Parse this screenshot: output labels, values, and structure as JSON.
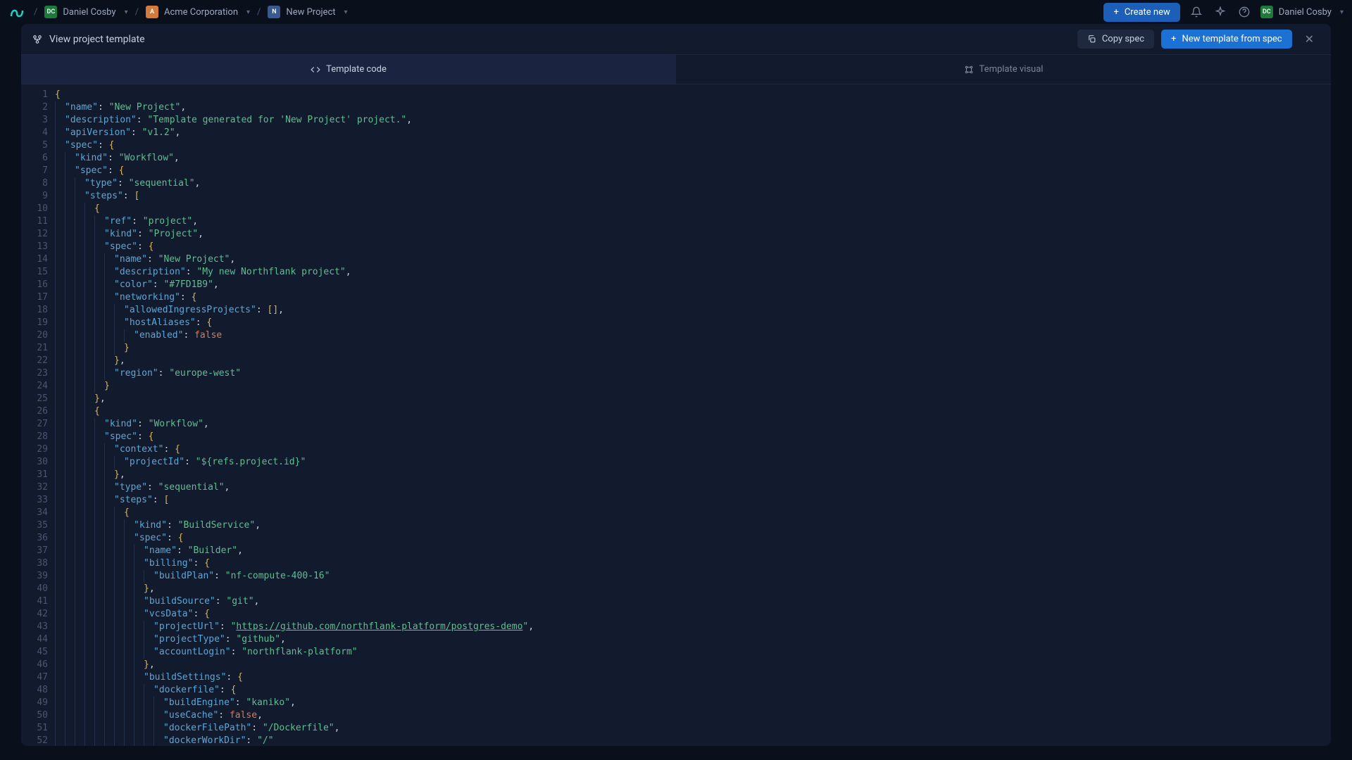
{
  "topbar": {
    "user": "Daniel Cosby",
    "org": "Acme Corporation",
    "project": "New Project",
    "create_new": "Create new"
  },
  "modal": {
    "title": "View project template",
    "copy_spec": "Copy spec",
    "new_template": "New template from spec"
  },
  "tabs": {
    "code": "Template code",
    "visual": "Template visual"
  },
  "code": {
    "lines": [
      {
        "n": 1,
        "i": 0,
        "t": [
          [
            "brace",
            "{"
          ]
        ]
      },
      {
        "n": 2,
        "i": 1,
        "t": [
          [
            "key",
            "\"name\""
          ],
          [
            "punct",
            ": "
          ],
          [
            "str",
            "\"New Project\""
          ],
          [
            "punct",
            ","
          ]
        ]
      },
      {
        "n": 3,
        "i": 1,
        "t": [
          [
            "key",
            "\"description\""
          ],
          [
            "punct",
            ": "
          ],
          [
            "str",
            "\"Template generated for 'New Project' project.\""
          ],
          [
            "punct",
            ","
          ]
        ]
      },
      {
        "n": 4,
        "i": 1,
        "t": [
          [
            "key",
            "\"apiVersion\""
          ],
          [
            "punct",
            ": "
          ],
          [
            "str",
            "\"v1.2\""
          ],
          [
            "punct",
            ","
          ]
        ]
      },
      {
        "n": 5,
        "i": 1,
        "t": [
          [
            "key",
            "\"spec\""
          ],
          [
            "punct",
            ": "
          ],
          [
            "brace",
            "{"
          ]
        ]
      },
      {
        "n": 6,
        "i": 2,
        "t": [
          [
            "key",
            "\"kind\""
          ],
          [
            "punct",
            ": "
          ],
          [
            "str",
            "\"Workflow\""
          ],
          [
            "punct",
            ","
          ]
        ]
      },
      {
        "n": 7,
        "i": 2,
        "t": [
          [
            "key",
            "\"spec\""
          ],
          [
            "punct",
            ": "
          ],
          [
            "brace",
            "{"
          ]
        ]
      },
      {
        "n": 8,
        "i": 3,
        "t": [
          [
            "key",
            "\"type\""
          ],
          [
            "punct",
            ": "
          ],
          [
            "str",
            "\"sequential\""
          ],
          [
            "punct",
            ","
          ]
        ]
      },
      {
        "n": 9,
        "i": 3,
        "t": [
          [
            "key",
            "\"steps\""
          ],
          [
            "punct",
            ": "
          ],
          [
            "brace",
            "["
          ]
        ]
      },
      {
        "n": 10,
        "i": 4,
        "t": [
          [
            "brace",
            "{"
          ]
        ]
      },
      {
        "n": 11,
        "i": 5,
        "t": [
          [
            "key",
            "\"ref\""
          ],
          [
            "punct",
            ": "
          ],
          [
            "str",
            "\"project\""
          ],
          [
            "punct",
            ","
          ]
        ]
      },
      {
        "n": 12,
        "i": 5,
        "t": [
          [
            "key",
            "\"kind\""
          ],
          [
            "punct",
            ": "
          ],
          [
            "str",
            "\"Project\""
          ],
          [
            "punct",
            ","
          ]
        ]
      },
      {
        "n": 13,
        "i": 5,
        "t": [
          [
            "key",
            "\"spec\""
          ],
          [
            "punct",
            ": "
          ],
          [
            "brace",
            "{"
          ]
        ]
      },
      {
        "n": 14,
        "i": 6,
        "t": [
          [
            "key",
            "\"name\""
          ],
          [
            "punct",
            ": "
          ],
          [
            "str",
            "\"New Project\""
          ],
          [
            "punct",
            ","
          ]
        ]
      },
      {
        "n": 15,
        "i": 6,
        "t": [
          [
            "key",
            "\"description\""
          ],
          [
            "punct",
            ": "
          ],
          [
            "str",
            "\"My new Northflank project\""
          ],
          [
            "punct",
            ","
          ]
        ]
      },
      {
        "n": 16,
        "i": 6,
        "t": [
          [
            "key",
            "\"color\""
          ],
          [
            "punct",
            ": "
          ],
          [
            "str",
            "\"#7FD1B9\""
          ],
          [
            "punct",
            ","
          ]
        ]
      },
      {
        "n": 17,
        "i": 6,
        "t": [
          [
            "key",
            "\"networking\""
          ],
          [
            "punct",
            ": "
          ],
          [
            "brace",
            "{"
          ]
        ]
      },
      {
        "n": 18,
        "i": 7,
        "t": [
          [
            "key",
            "\"allowedIngressProjects\""
          ],
          [
            "punct",
            ": "
          ],
          [
            "brace",
            "[]"
          ],
          [
            "punct",
            ","
          ]
        ]
      },
      {
        "n": 19,
        "i": 7,
        "t": [
          [
            "key",
            "\"hostAliases\""
          ],
          [
            "punct",
            ": "
          ],
          [
            "brace",
            "{"
          ]
        ]
      },
      {
        "n": 20,
        "i": 8,
        "t": [
          [
            "key",
            "\"enabled\""
          ],
          [
            "punct",
            ": "
          ],
          [
            "bool",
            "false"
          ]
        ]
      },
      {
        "n": 21,
        "i": 7,
        "t": [
          [
            "brace",
            "}"
          ]
        ]
      },
      {
        "n": 22,
        "i": 6,
        "t": [
          [
            "brace",
            "}"
          ],
          [
            "punct",
            ","
          ]
        ]
      },
      {
        "n": 23,
        "i": 6,
        "t": [
          [
            "key",
            "\"region\""
          ],
          [
            "punct",
            ": "
          ],
          [
            "str",
            "\"europe-west\""
          ]
        ]
      },
      {
        "n": 24,
        "i": 5,
        "t": [
          [
            "brace",
            "}"
          ]
        ]
      },
      {
        "n": 25,
        "i": 4,
        "t": [
          [
            "brace",
            "}"
          ],
          [
            "punct",
            ","
          ]
        ]
      },
      {
        "n": 26,
        "i": 4,
        "t": [
          [
            "brace",
            "{"
          ]
        ]
      },
      {
        "n": 27,
        "i": 5,
        "t": [
          [
            "key",
            "\"kind\""
          ],
          [
            "punct",
            ": "
          ],
          [
            "str",
            "\"Workflow\""
          ],
          [
            "punct",
            ","
          ]
        ]
      },
      {
        "n": 28,
        "i": 5,
        "t": [
          [
            "key",
            "\"spec\""
          ],
          [
            "punct",
            ": "
          ],
          [
            "brace",
            "{"
          ]
        ]
      },
      {
        "n": 29,
        "i": 6,
        "t": [
          [
            "key",
            "\"context\""
          ],
          [
            "punct",
            ": "
          ],
          [
            "brace",
            "{"
          ]
        ]
      },
      {
        "n": 30,
        "i": 7,
        "t": [
          [
            "key",
            "\"projectId\""
          ],
          [
            "punct",
            ": "
          ],
          [
            "str",
            "\"${refs.project.id}\""
          ]
        ]
      },
      {
        "n": 31,
        "i": 6,
        "t": [
          [
            "brace",
            "}"
          ],
          [
            "punct",
            ","
          ]
        ]
      },
      {
        "n": 32,
        "i": 6,
        "t": [
          [
            "key",
            "\"type\""
          ],
          [
            "punct",
            ": "
          ],
          [
            "str",
            "\"sequential\""
          ],
          [
            "punct",
            ","
          ]
        ]
      },
      {
        "n": 33,
        "i": 6,
        "t": [
          [
            "key",
            "\"steps\""
          ],
          [
            "punct",
            ": "
          ],
          [
            "brace",
            "["
          ]
        ]
      },
      {
        "n": 34,
        "i": 7,
        "t": [
          [
            "brace",
            "{"
          ]
        ]
      },
      {
        "n": 35,
        "i": 8,
        "t": [
          [
            "key",
            "\"kind\""
          ],
          [
            "punct",
            ": "
          ],
          [
            "str",
            "\"BuildService\""
          ],
          [
            "punct",
            ","
          ]
        ]
      },
      {
        "n": 36,
        "i": 8,
        "t": [
          [
            "key",
            "\"spec\""
          ],
          [
            "punct",
            ": "
          ],
          [
            "brace",
            "{"
          ]
        ]
      },
      {
        "n": 37,
        "i": 9,
        "t": [
          [
            "key",
            "\"name\""
          ],
          [
            "punct",
            ": "
          ],
          [
            "str",
            "\"Builder\""
          ],
          [
            "punct",
            ","
          ]
        ]
      },
      {
        "n": 38,
        "i": 9,
        "t": [
          [
            "key",
            "\"billing\""
          ],
          [
            "punct",
            ": "
          ],
          [
            "brace",
            "{"
          ]
        ]
      },
      {
        "n": 39,
        "i": 10,
        "t": [
          [
            "key",
            "\"buildPlan\""
          ],
          [
            "punct",
            ": "
          ],
          [
            "str",
            "\"nf-compute-400-16\""
          ]
        ]
      },
      {
        "n": 40,
        "i": 9,
        "t": [
          [
            "brace",
            "}"
          ],
          [
            "punct",
            ","
          ]
        ]
      },
      {
        "n": 41,
        "i": 9,
        "t": [
          [
            "key",
            "\"buildSource\""
          ],
          [
            "punct",
            ": "
          ],
          [
            "str",
            "\"git\""
          ],
          [
            "punct",
            ","
          ]
        ]
      },
      {
        "n": 42,
        "i": 9,
        "t": [
          [
            "key",
            "\"vcsData\""
          ],
          [
            "punct",
            ": "
          ],
          [
            "brace",
            "{"
          ]
        ]
      },
      {
        "n": 43,
        "i": 10,
        "t": [
          [
            "key",
            "\"projectUrl\""
          ],
          [
            "punct",
            ": "
          ],
          [
            "str",
            "\""
          ],
          [
            "url",
            "https://github.com/northflank-platform/postgres-demo"
          ],
          [
            "str",
            "\""
          ],
          [
            "punct",
            ","
          ]
        ]
      },
      {
        "n": 44,
        "i": 10,
        "t": [
          [
            "key",
            "\"projectType\""
          ],
          [
            "punct",
            ": "
          ],
          [
            "str",
            "\"github\""
          ],
          [
            "punct",
            ","
          ]
        ]
      },
      {
        "n": 45,
        "i": 10,
        "t": [
          [
            "key",
            "\"accountLogin\""
          ],
          [
            "punct",
            ": "
          ],
          [
            "str",
            "\"northflank-platform\""
          ]
        ]
      },
      {
        "n": 46,
        "i": 9,
        "t": [
          [
            "brace",
            "}"
          ],
          [
            "punct",
            ","
          ]
        ]
      },
      {
        "n": 47,
        "i": 9,
        "t": [
          [
            "key",
            "\"buildSettings\""
          ],
          [
            "punct",
            ": "
          ],
          [
            "brace",
            "{"
          ]
        ]
      },
      {
        "n": 48,
        "i": 10,
        "t": [
          [
            "key",
            "\"dockerfile\""
          ],
          [
            "punct",
            ": "
          ],
          [
            "brace",
            "{"
          ]
        ]
      },
      {
        "n": 49,
        "i": 11,
        "t": [
          [
            "key",
            "\"buildEngine\""
          ],
          [
            "punct",
            ": "
          ],
          [
            "str",
            "\"kaniko\""
          ],
          [
            "punct",
            ","
          ]
        ]
      },
      {
        "n": 50,
        "i": 11,
        "t": [
          [
            "key",
            "\"useCache\""
          ],
          [
            "punct",
            ": "
          ],
          [
            "bool",
            "false"
          ],
          [
            "punct",
            ","
          ]
        ]
      },
      {
        "n": 51,
        "i": 11,
        "t": [
          [
            "key",
            "\"dockerFilePath\""
          ],
          [
            "punct",
            ": "
          ],
          [
            "str",
            "\"/Dockerfile\""
          ],
          [
            "punct",
            ","
          ]
        ]
      },
      {
        "n": 52,
        "i": 11,
        "t": [
          [
            "key",
            "\"dockerWorkDir\""
          ],
          [
            "punct",
            ": "
          ],
          [
            "str",
            "\"/\""
          ]
        ]
      }
    ]
  }
}
